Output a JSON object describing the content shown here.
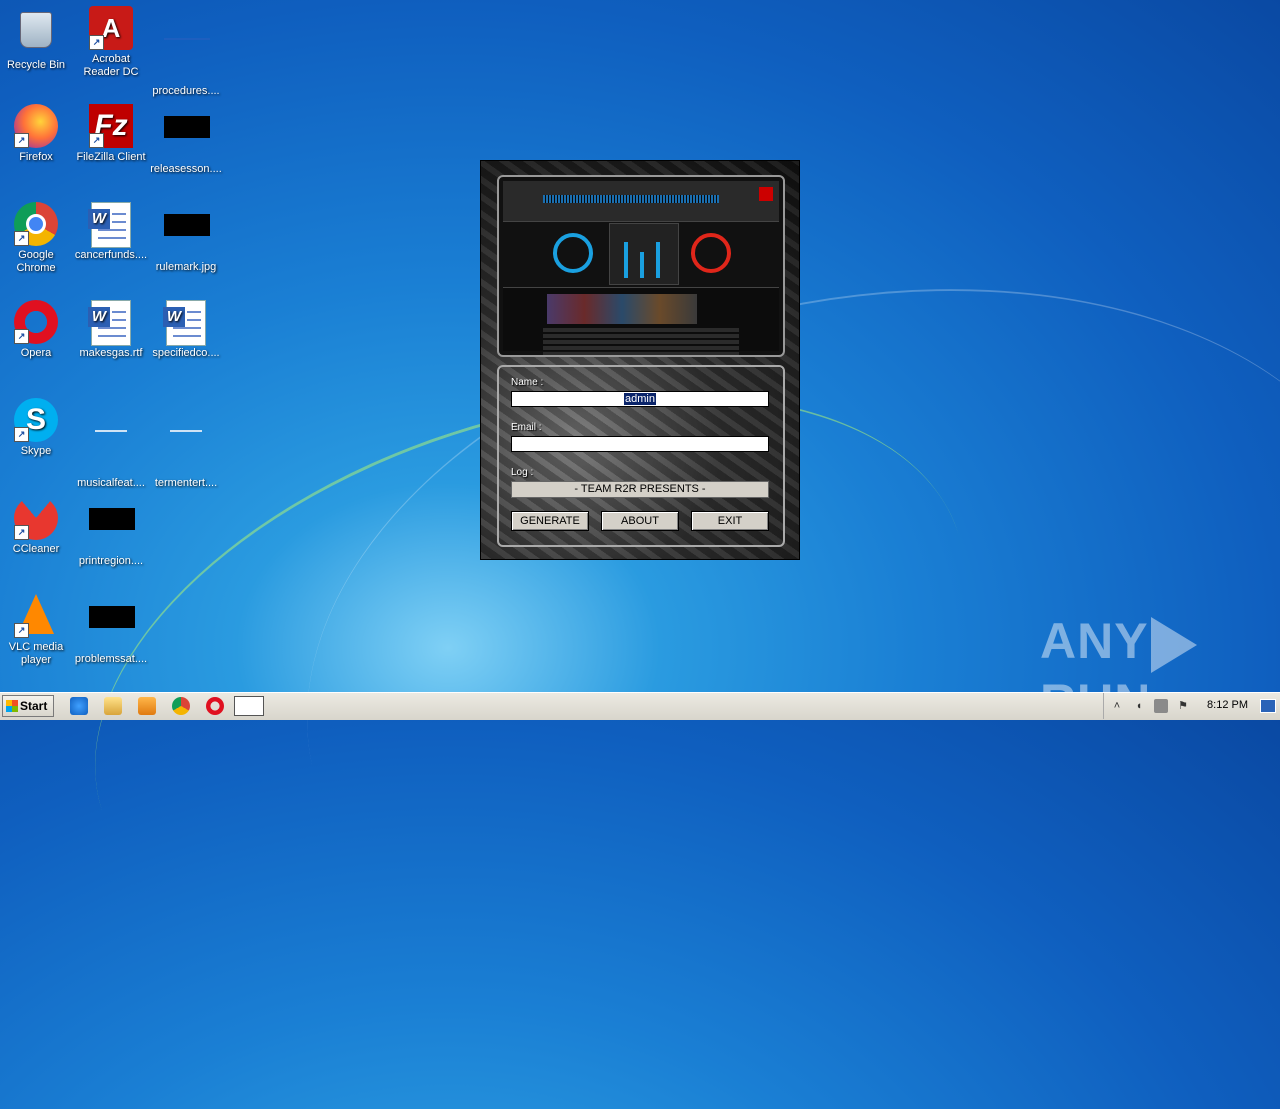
{
  "desktop": {
    "icons": [
      {
        "label": "Recycle Bin"
      },
      {
        "label": "Acrobat Reader DC"
      },
      {
        "label": "procedures...."
      },
      {
        "label": "Firefox"
      },
      {
        "label": "FileZilla Client"
      },
      {
        "label": "releasesson...."
      },
      {
        "label": "Google Chrome"
      },
      {
        "label": "cancerfunds...."
      },
      {
        "label": "rulemark.jpg"
      },
      {
        "label": "Opera"
      },
      {
        "label": "makesgas.rtf"
      },
      {
        "label": "specifiedco...."
      },
      {
        "label": "Skype"
      },
      {
        "label": "musicalfeat...."
      },
      {
        "label": "termentert...."
      },
      {
        "label": "CCleaner"
      },
      {
        "label": "printregion...."
      },
      {
        "label": "VLC media player"
      },
      {
        "label": "problemssat...."
      }
    ]
  },
  "dialog": {
    "name_label": "Name :",
    "name_value": "admin",
    "email_label": "Email :",
    "email_value": "",
    "log_label": "Log :",
    "log_value": "- TEAM R2R PRESENTS -",
    "generate_label": "GENERATE",
    "about_label": "ABOUT",
    "exit_label": "EXIT"
  },
  "taskbar": {
    "start_label": "Start",
    "clock": "8:12 PM"
  },
  "watermark": {
    "left": "ANY",
    "right": "RUN"
  }
}
